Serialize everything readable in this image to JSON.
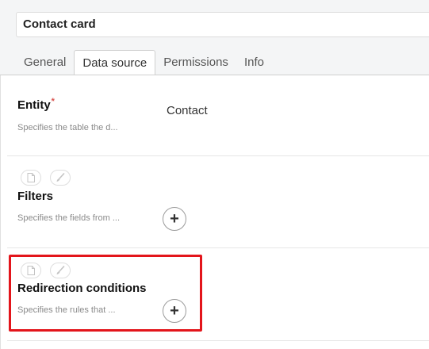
{
  "header": {
    "title": "Contact card"
  },
  "tabs": [
    {
      "label": "General"
    },
    {
      "label": "Data source"
    },
    {
      "label": "Permissions"
    },
    {
      "label": "Info"
    }
  ],
  "active_tab": "Data source",
  "fields": {
    "entity": {
      "label": "Entity",
      "required_mark": "*",
      "description": "Specifies the table the d...",
      "value": "Contact"
    },
    "filters": {
      "label": "Filters",
      "description": "Specifies the fields from ...",
      "add_label": "+"
    },
    "redirection": {
      "label": "Redirection conditions",
      "description": "Specifies the rules that ...",
      "add_label": "+"
    }
  },
  "icons": [
    "document-icon",
    "brush-icon"
  ],
  "colors": {
    "highlight": "#e3151b",
    "required": "#d9534f"
  }
}
